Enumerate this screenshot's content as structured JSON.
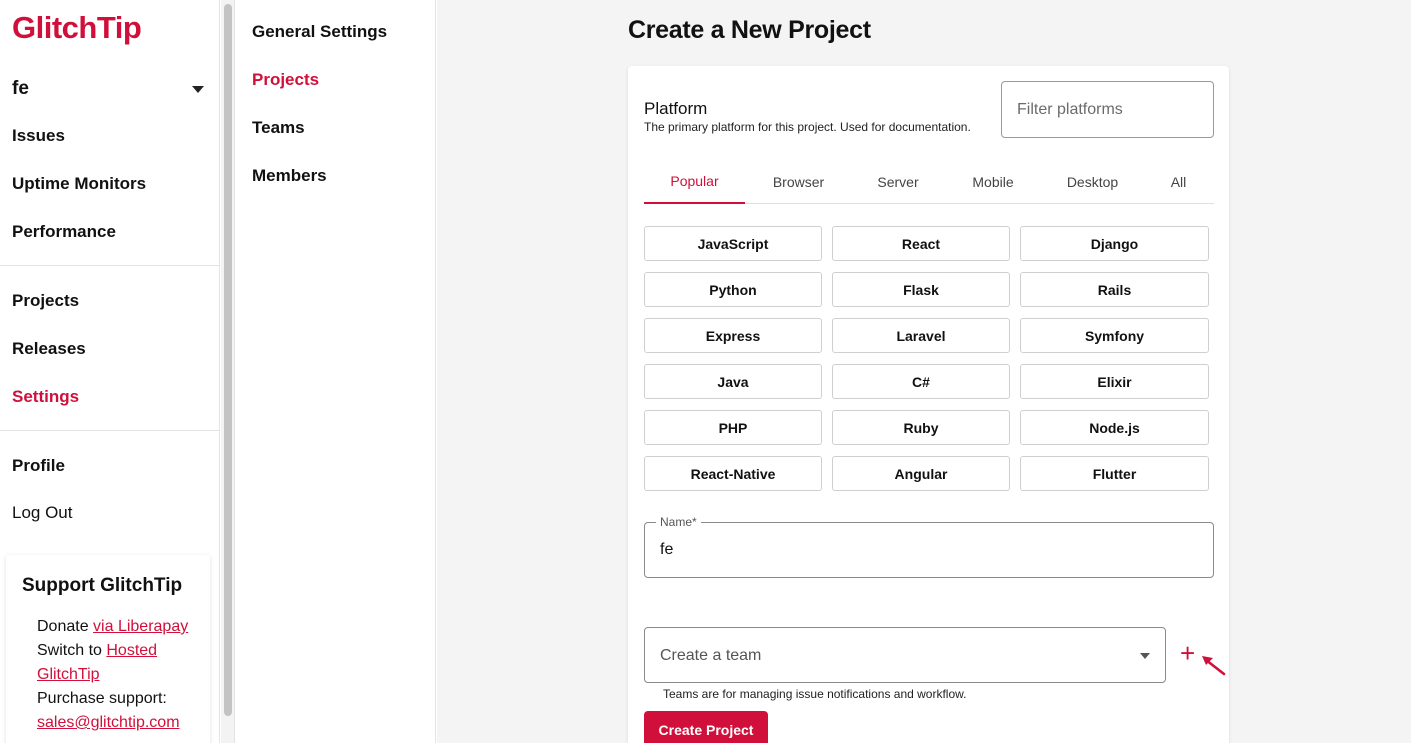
{
  "sidebar": {
    "logo": "GlitchTip",
    "org": "fe",
    "items": [
      {
        "label": "Issues"
      },
      {
        "label": "Uptime Monitors"
      },
      {
        "label": "Performance"
      },
      {
        "label": "Projects"
      },
      {
        "label": "Releases"
      },
      {
        "label": "Settings"
      },
      {
        "label": "Profile"
      },
      {
        "label": "Log Out"
      }
    ],
    "support": {
      "title": "Support GlitchTip",
      "donate_prefix": "Donate ",
      "donate_link": "via Liberapay",
      "switch_prefix": "Switch to ",
      "switch_link": "Hosted GlitchTip",
      "purchase": "Purchase support:",
      "email": "sales@glitchtip.com"
    }
  },
  "subnav": {
    "items": [
      {
        "label": "General Settings"
      },
      {
        "label": "Projects"
      },
      {
        "label": "Teams"
      },
      {
        "label": "Members"
      }
    ]
  },
  "main": {
    "title": "Create a New Project",
    "platform_label": "Platform",
    "platform_desc": "The primary platform for this project. Used for documentation.",
    "filter_placeholder": "Filter platforms",
    "tabs": [
      "Popular",
      "Browser",
      "Server",
      "Mobile",
      "Desktop",
      "All"
    ],
    "platforms": [
      "JavaScript",
      "React",
      "Django",
      "Python",
      "Flask",
      "Rails",
      "Express",
      "Laravel",
      "Symfony",
      "Java",
      "C#",
      "Elixir",
      "PHP",
      "Ruby",
      "Node.js",
      "React-Native",
      "Angular",
      "Flutter"
    ],
    "name_label": "Name*",
    "name_value": "fe",
    "team_placeholder": "Create a team",
    "add_symbol": "+",
    "team_help": "Teams are for managing issue notifications and workflow.",
    "create_label": "Create Project"
  },
  "colors": {
    "accent": "#d0103a"
  }
}
